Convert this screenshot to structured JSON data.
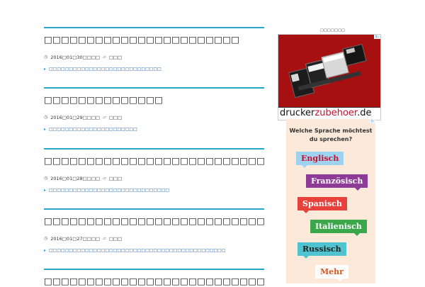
{
  "posts": [
    {
      "title": "□□□□□□□□□□□□□□□□□□□□□□□",
      "date": "2016□01□30□□□□",
      "category": "□□□",
      "link": "□□□□□□□□□□□□□□□□□□□□□□□□□□□□"
    },
    {
      "title": "□□□□□□□□□□□□□□",
      "date": "2016□01□29□□□□",
      "category": "□□□",
      "link": "□□□□□□□□□□□□□□□□□□□□□□"
    },
    {
      "title": "□□□□□□□□□□□□□□□□□□□□□□□□□□",
      "date": "2016□01□28□□□□",
      "category": "□□□",
      "link": "□□□□□□□□□□□□□□□□□□□□□□□□□□□□□□"
    },
    {
      "title": "□□□□□□□□□□□□□□□□□□□□□□□□□□□□□□□□□□□□□□□□□",
      "date": "2016□01□27□□□□",
      "category": "□□□",
      "link": "□□□□□□□□□□□□□□□□□□□□□□□□□□□□□□□□□□□□□□□□□□□□"
    },
    {
      "title": "□□□□□□□□□□□□□□□□□□□□□□□□□□",
      "date": "",
      "category": "",
      "link": ""
    }
  ],
  "sidebar": {
    "heading": "□□□□□□□",
    "ad1": {
      "brand_main": "drucker",
      "brand_accent": "zubehoer",
      "brand_tld": ".de",
      "adchoices": "i▷"
    },
    "ad2": {
      "adchoices": "▷",
      "question": "Welche Sprache möchtest du sprechen?",
      "languages": [
        "Englisch",
        "Französisch",
        "Spanisch",
        "Italienisch",
        "Russisch",
        "Mehr"
      ]
    }
  },
  "colors": {
    "accent": "#2aa5c9",
    "link": "#1a5a9b",
    "ad_red": "#a61010"
  }
}
